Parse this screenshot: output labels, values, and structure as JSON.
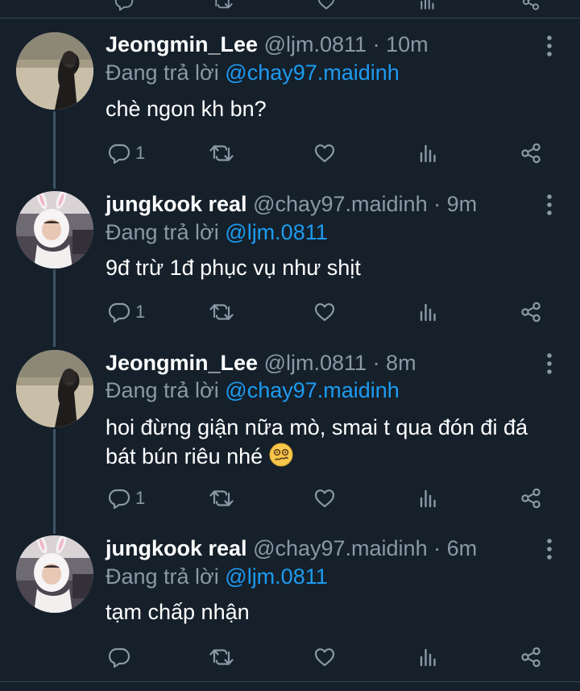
{
  "tweets": [
    {
      "name": "Jeongmin_Lee",
      "handle": "@ljm.0811",
      "time": "· 10m",
      "reply_prefix": "Đang trả lời",
      "reply_handle": "@chay97.maidinh",
      "text": "chè ngon kh bn?",
      "reply_count": "1",
      "avatar": "photo-person-beach"
    },
    {
      "name": "jungkook real",
      "handle": "@chay97.maidinh",
      "time": "· 9m",
      "reply_prefix": "Đang trả lời",
      "reply_handle": "@ljm.0811",
      "text": "9đ trừ 1đ phục vụ như shịt",
      "reply_count": "1",
      "avatar": "photo-bunny-costume"
    },
    {
      "name": "Jeongmin_Lee",
      "handle": "@ljm.0811",
      "time": "· 8m",
      "reply_prefix": "Đang trả lời",
      "reply_handle": "@chay97.maidinh",
      "text_line1": "hoi đừng giận nữa mò, smai t qua đón đi đá",
      "text_line2": "bát bún riêu nhé",
      "emoji": "woozy-face",
      "reply_count": "1",
      "avatar": "photo-person-beach"
    },
    {
      "name": "jungkook real",
      "handle": "@chay97.maidinh",
      "time": "· 6m",
      "reply_prefix": "Đang trả lời",
      "reply_handle": "@ljm.0811",
      "text": "tạm chấp nhận",
      "reply_count": "",
      "avatar": "photo-bunny-costume"
    }
  ],
  "icons": [
    "reply-icon",
    "retweet-icon",
    "like-icon",
    "views-icon",
    "share-icon",
    "more-icon"
  ],
  "colors": {
    "background": "#15202b",
    "link": "#1d9bf0",
    "muted": "#8b98a5",
    "divider": "#38444d"
  }
}
